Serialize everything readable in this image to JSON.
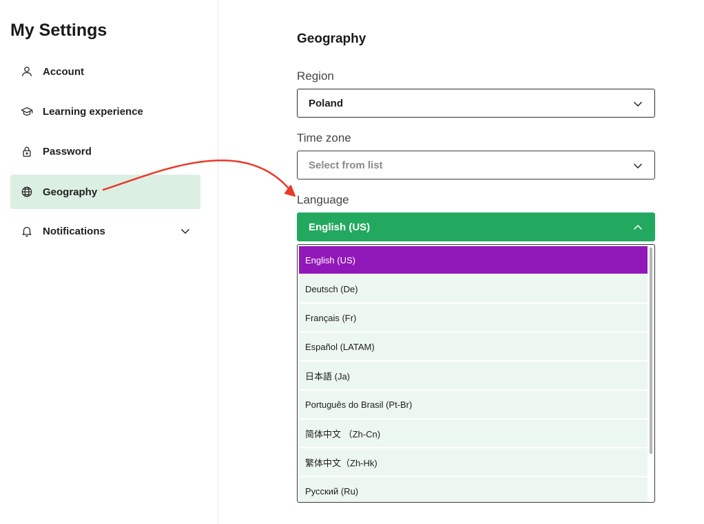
{
  "sidebar": {
    "title": "My Settings",
    "items": [
      {
        "label": "Account",
        "icon": "user-icon"
      },
      {
        "label": "Learning experience",
        "icon": "graduation-cap-icon"
      },
      {
        "label": "Password",
        "icon": "lock-icon"
      },
      {
        "label": "Geography",
        "icon": "globe-icon",
        "active": true
      },
      {
        "label": "Notifications",
        "icon": "bell-icon",
        "has_submenu": true
      }
    ]
  },
  "main": {
    "section_title": "Geography",
    "region": {
      "label": "Region",
      "value": "Poland"
    },
    "time_zone": {
      "label": "Time zone",
      "placeholder": "Select from list"
    },
    "language": {
      "label": "Language",
      "value": "English (US)",
      "options": [
        "English (US)",
        "Deutsch (De)",
        "Français (Fr)",
        "Español (LATAM)",
        "日本語 (Ja)",
        "Português do Brasil (Pt-Br)",
        "简体中文 （Zh-Cn)",
        "繁体中文（Zh-Hk)",
        "Русский (Ru)"
      ],
      "selected_index": 0
    }
  },
  "colors": {
    "active_nav_bg": "#dcefe3",
    "select_open_bg": "#22a95f",
    "selected_option_bg": "#9118b8",
    "option_bg": "#edf7f1",
    "annotation_arrow": "#e8392b"
  }
}
